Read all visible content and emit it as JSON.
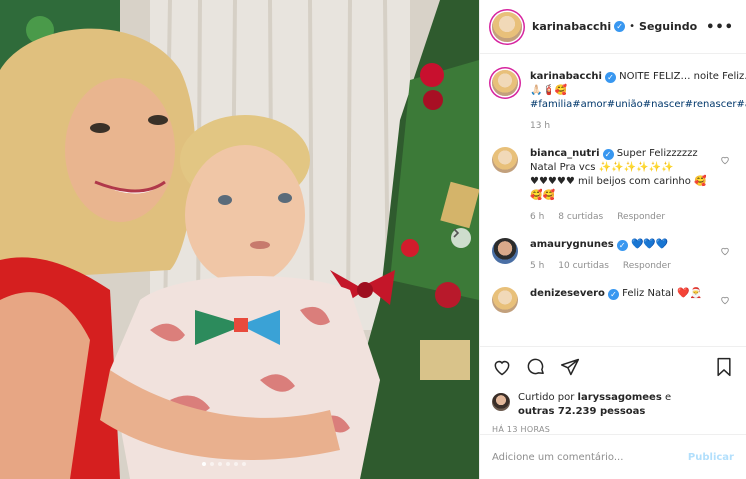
{
  "post": {
    "username": "karinabacchi",
    "follow_status": "Seguindo",
    "separator": "•",
    "more_icon": "more-horizontal-icon"
  },
  "caption": {
    "username": "karinabacchi",
    "text": "NOITE FELIZ… noite Feliz… NATAL",
    "emoji": "🙏🏻🧯🥰",
    "hashtags": "#familia#amor#união#nascer#renascer#agradecer",
    "age": "13 h"
  },
  "comments": [
    {
      "username": "bianca_nutri",
      "verified": true,
      "text": "Super Felizzzzzz Natal Pra vcs ✨✨✨✨✨✨ ♥♥♥♥♥ mil beijos com carinho 🥰🥰🥰",
      "age": "6 h",
      "likes": "8 curtidas",
      "reply": "Responder"
    },
    {
      "username": "amaurygnunes",
      "verified": true,
      "text": "💙💙💙",
      "age": "5 h",
      "likes": "10 curtidas",
      "reply": "Responder"
    },
    {
      "username": "denizesevero",
      "verified": true,
      "text": "Feliz Natal ❤️🎅",
      "age": "",
      "likes": "",
      "reply": ""
    }
  ],
  "likes": {
    "prefix": "Curtido por",
    "user": "laryssagomees",
    "middle": "e",
    "others": "outras 72.239 pessoas"
  },
  "timestamp": "HÁ 13 HORAS",
  "comment_box": {
    "placeholder": "Adicione um comentário...",
    "publish_label": "Publicar"
  },
  "carousel": {
    "total_dots": 6,
    "active_index": 0
  },
  "colors": {
    "link": "#00376b",
    "verified": "#3897f0",
    "muted": "#8e8e8e",
    "publish_disabled": "#b2dffc"
  }
}
